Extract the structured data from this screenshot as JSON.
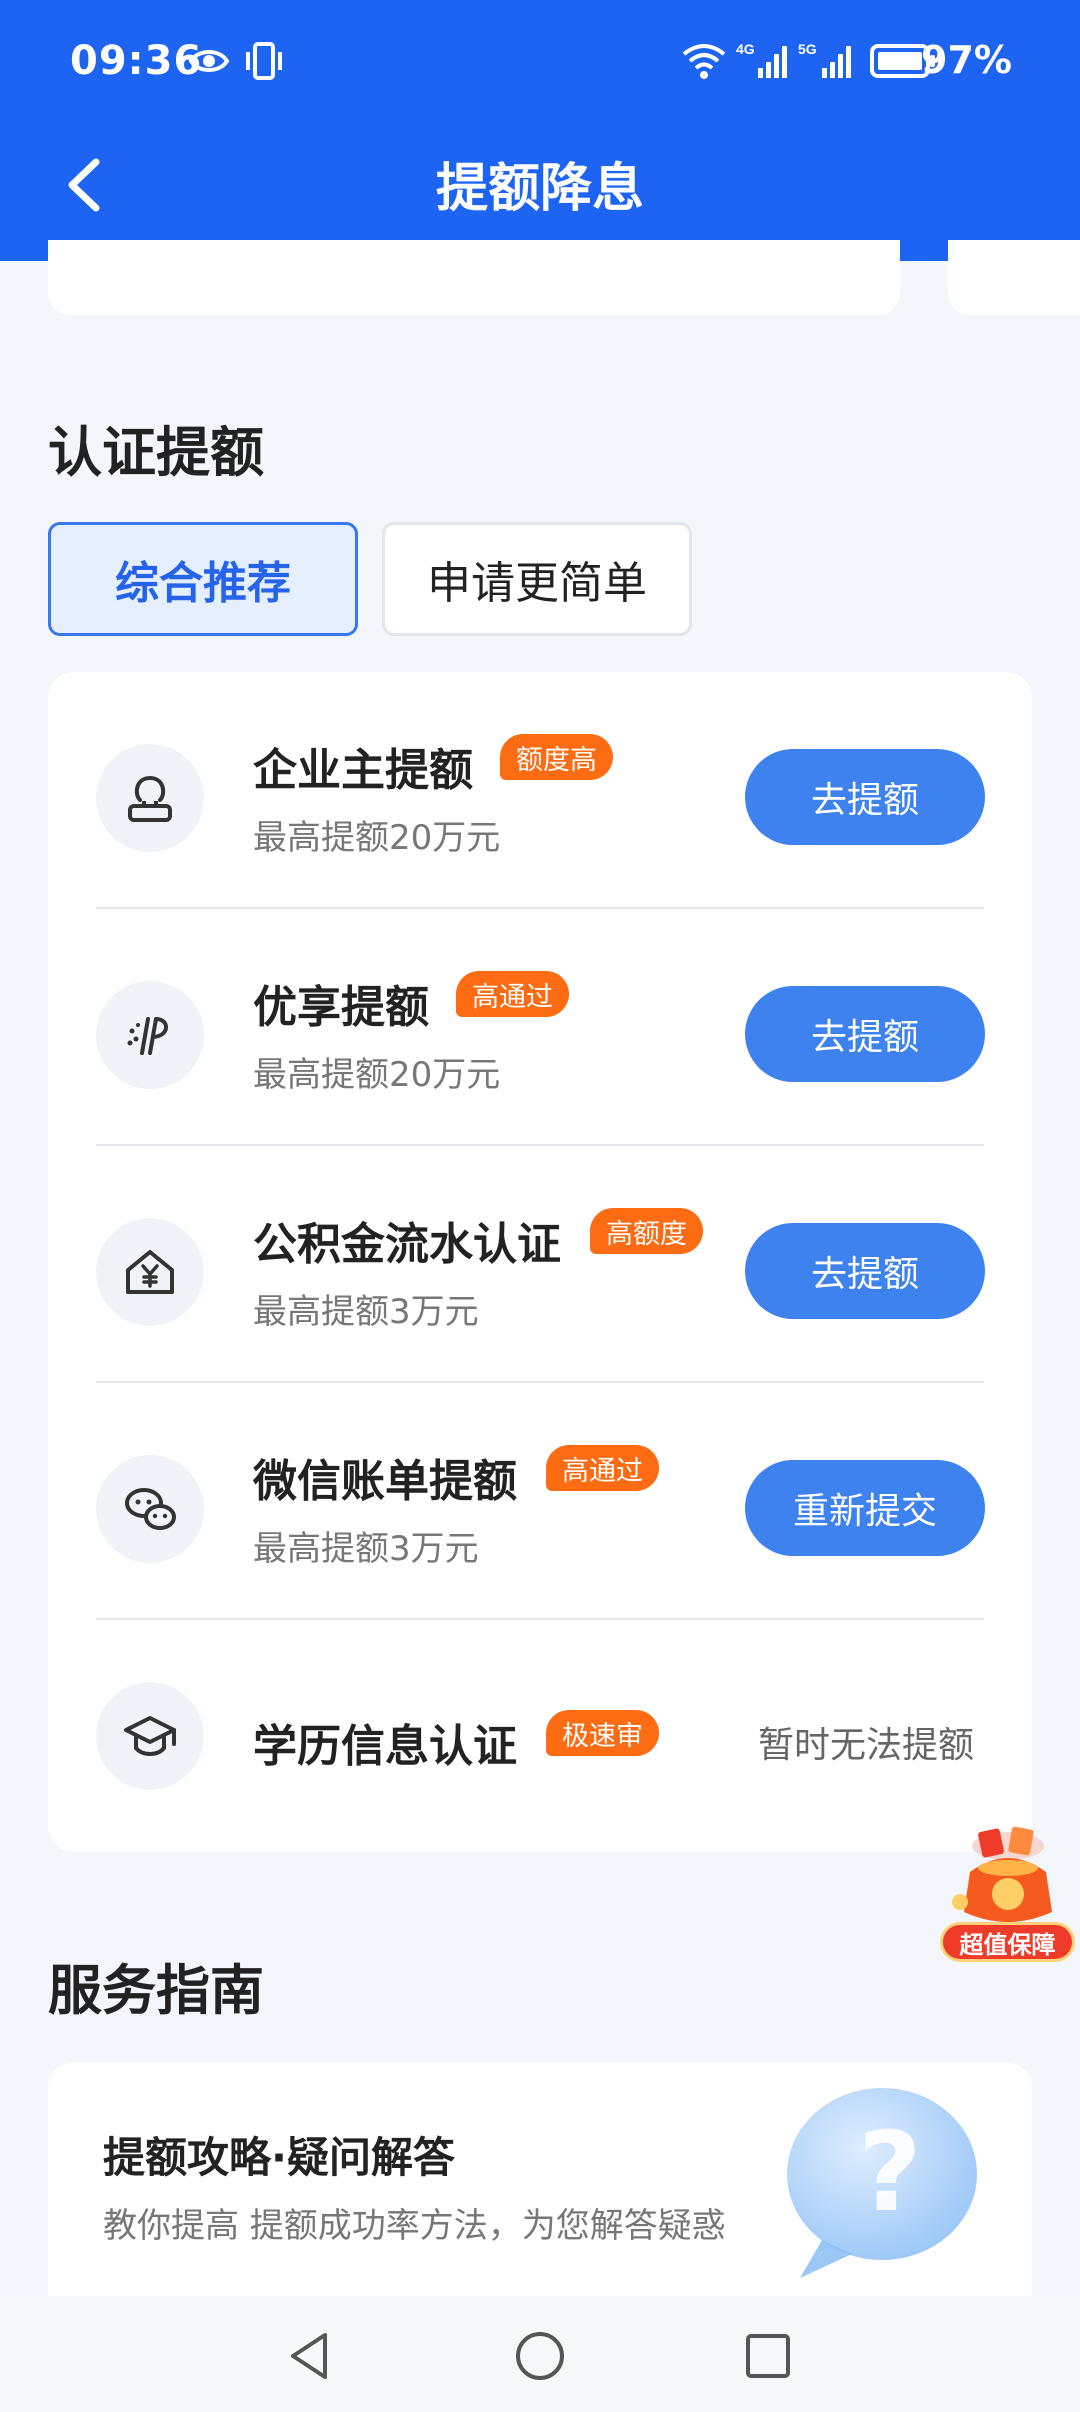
{
  "status_bar": {
    "time": "09:36",
    "battery": "97%",
    "icons": [
      "eye-icon",
      "vibrate-icon",
      "wifi-icon",
      "signal-4g-icon",
      "signal-5g-icon",
      "battery-icon"
    ]
  },
  "header": {
    "title": "提额降息",
    "back_icon": "back-arrow-icon",
    "color": "#1e64f3"
  },
  "cert_section": {
    "title": "认证提额",
    "tabs": [
      {
        "label": "综合推荐",
        "active": true
      },
      {
        "label": "申请更简单",
        "active": false
      }
    ],
    "items": [
      {
        "icon": "person-icon",
        "title": "企业主提额",
        "badge": "额度高",
        "subtitle": "最高提额20万元",
        "action": "去提额"
      },
      {
        "icon": "premium-icon",
        "title": "优享提额",
        "badge": "高通过",
        "subtitle": "最高提额20万元",
        "action": "去提额"
      },
      {
        "icon": "house-yen-icon",
        "title": "公积金流水认证",
        "badge": "高额度",
        "subtitle": "最高提额3万元",
        "action": "去提额"
      },
      {
        "icon": "wechat-icon",
        "title": "微信账单提额",
        "badge": "高通过",
        "subtitle": "最高提额3万元",
        "action": "重新提交"
      },
      {
        "icon": "graduation-cap-icon",
        "title": "学历信息认证",
        "badge": "极速审",
        "subtitle": "",
        "status": "暂时无法提额"
      }
    ]
  },
  "promo": {
    "label": "超值保障",
    "icon": "lucky-bag-icon"
  },
  "guide_section": {
    "title": "服务指南",
    "card": {
      "title": "提额攻略·疑问解答",
      "description": "教你提高 提额成功率方法，为您解答疑惑",
      "icon": "question-bubble-icon"
    }
  },
  "system_nav": [
    "nav-back-icon",
    "nav-home-icon",
    "nav-recents-icon"
  ]
}
